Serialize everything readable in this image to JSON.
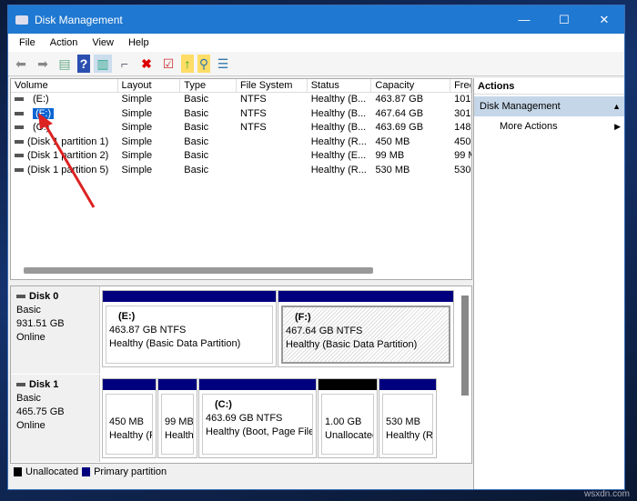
{
  "window": {
    "title": "Disk Management",
    "minimize": "—",
    "maximize": "☐",
    "close": "✕"
  },
  "menu": [
    "File",
    "Action",
    "View",
    "Help"
  ],
  "list": {
    "headers": [
      "Volume",
      "Layout",
      "Type",
      "File System",
      "Status",
      "Capacity",
      "Free"
    ],
    "rows": [
      [
        "(E:)",
        "Simple",
        "Basic",
        "NTFS",
        "Healthy (B...",
        "463.87 GB",
        "101"
      ],
      [
        "(F:)",
        "Simple",
        "Basic",
        "NTFS",
        "Healthy (B...",
        "467.64 GB",
        "301"
      ],
      [
        "(C:)",
        "Simple",
        "Basic",
        "NTFS",
        "Healthy (B...",
        "463.69 GB",
        "148"
      ],
      [
        "(Disk 1 partition 1)",
        "Simple",
        "Basic",
        "",
        "Healthy (R...",
        "450 MB",
        "450"
      ],
      [
        "(Disk 1 partition 2)",
        "Simple",
        "Basic",
        "",
        "Healthy (E...",
        "99 MB",
        "99 M"
      ],
      [
        "(Disk 1 partition 5)",
        "Simple",
        "Basic",
        "",
        "Healthy (R...",
        "530 MB",
        "530"
      ]
    ]
  },
  "actions": {
    "title": "Actions",
    "section": "Disk Management",
    "more": "More Actions"
  },
  "disks": [
    {
      "name": "Disk 0",
      "type": "Basic",
      "size": "931.51 GB",
      "status": "Online",
      "parts": [
        {
          "label": "(E:)",
          "size": "463.87 GB NTFS",
          "status": "Healthy (Basic Data Partition)"
        },
        {
          "label": "(F:)",
          "size": "467.64 GB NTFS",
          "status": "Healthy (Basic Data Partition)"
        }
      ]
    },
    {
      "name": "Disk 1",
      "type": "Basic",
      "size": "465.75 GB",
      "status": "Online",
      "parts": [
        {
          "label": "",
          "size": "450 MB",
          "status": "Healthy (F"
        },
        {
          "label": "",
          "size": "99 MB",
          "status": "Health"
        },
        {
          "label": "(C:)",
          "size": "463.69 GB NTFS",
          "status": "Healthy (Boot, Page File"
        },
        {
          "label": "",
          "size": "1.00 GB",
          "status": "Unallocatec"
        },
        {
          "label": "",
          "size": "530 MB",
          "status": "Healthy (R"
        }
      ]
    }
  ],
  "legend": {
    "unallocated": "Unallocated",
    "primary": "Primary partition",
    "unallocated_color": "#000000",
    "primary_color": "#00007f"
  },
  "watermark": "wsxdn.com"
}
